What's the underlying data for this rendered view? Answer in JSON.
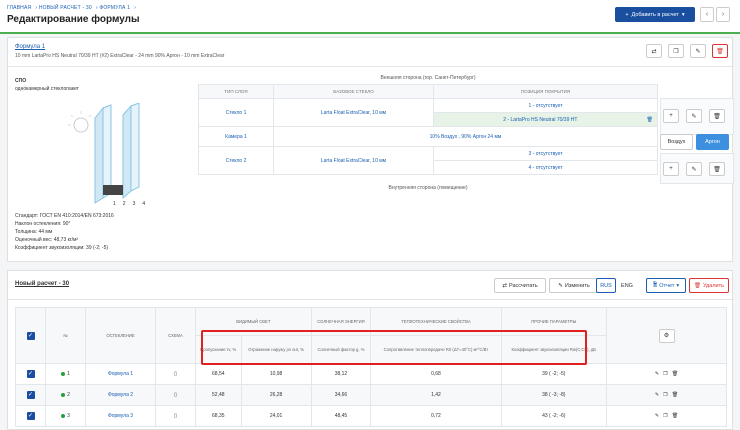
{
  "breadcrumb": [
    "ГЛАВНАЯ",
    "НОВЫЙ РАСЧЕТ - 30",
    "ФОРМУЛА 1"
  ],
  "page_title": "Редактирование формулы",
  "add_button": "Добавить в расчет",
  "formula": {
    "title": "Формула 1",
    "description": "10 mm LartaPro HS Neutral 70/39 HT (#2) ExtraClear - 24 mm 90% Аргон - 10 mm ExtraClear"
  },
  "unit": {
    "label": "СПО",
    "type": "однокамерный стеклопакет",
    "dims": [
      "1",
      "2",
      "3",
      "4"
    ],
    "specs": [
      "Стандарт: ГОСТ EN 410:2014/EN 673:2016",
      "Наклон остекления: 90°",
      "Толщина: 44 мм",
      "Оценочный вес: 48,73 кг/м²",
      "Коэффициент звукоизоляции: 39 (-2; -5)"
    ]
  },
  "outside_label": "Внешняя сторона (гор. Санкт-Петербург)",
  "inside_label": "Внутренняя сторона (помещение)",
  "glass_headers": [
    "ТИП СЛОЯ",
    "БАЗОВОЕ СТЕКЛО",
    "ПОЗИЦИЯ ПОКРЫТИЯ"
  ],
  "layers": [
    {
      "type": "Стекло 1",
      "base": "Larta Float ExtraClear, 10 мм",
      "pos": [
        "1 - отсутствует",
        "2 - LartaPro HS Neutral 70/39 HT"
      ]
    },
    {
      "type": "Камера 1",
      "base": "10% Воздух , 90% Аргон 24 мм",
      "gas": [
        "Воздух",
        "Аргон"
      ]
    },
    {
      "type": "Стекло 2",
      "base": "Larta Float ExtraClear, 10 мм",
      "pos": [
        "3 - отсутствует",
        "4 - отсутствует"
      ]
    }
  ],
  "calc": {
    "title": "Новый расчет - 30",
    "calc_btn": "Рассчитать",
    "edit_btn": "Изменить",
    "lang": [
      "RUS",
      "ENG"
    ],
    "report": "Отчет",
    "delete": "Удалить"
  },
  "table": {
    "cols": [
      "№",
      "ОСТЕКЛЕНИЕ",
      "СХЕМА"
    ],
    "groups": [
      "ВИДИМЫЙ СВЕТ",
      "СОЛНЕЧНАЯ ЭНЕРГИЯ",
      "ТЕПЛОТЕХНИЧЕСКИЕ СВОЙСТВА",
      "ПРОЧИЕ ПАРАМЕТРЫ"
    ],
    "sub": [
      "Пропускание τv, %",
      "Отражение наружу ρv out, %",
      "Солнечный фактор g, %",
      "Сопротивление теплопередаче R0 (ΔT=40°C) м²°С/Вт",
      "Коэффициент звукоизоляции Rw(C;Ctr), дБ"
    ],
    "rows": [
      {
        "n": "1",
        "name": "Формула 1",
        "v": [
          "68,54",
          "10,98",
          "38,12",
          "0,68",
          "39 ( -2; -5)"
        ]
      },
      {
        "n": "2",
        "name": "Формула 2",
        "v": [
          "52,48",
          "26,28",
          "34,66",
          "1,42",
          "38 ( -3; -8)"
        ]
      },
      {
        "n": "3",
        "name": "Формула 3",
        "v": [
          "68,35",
          "24,01",
          "48,45",
          "0,72",
          "43 ( -2; -6)"
        ]
      }
    ]
  }
}
